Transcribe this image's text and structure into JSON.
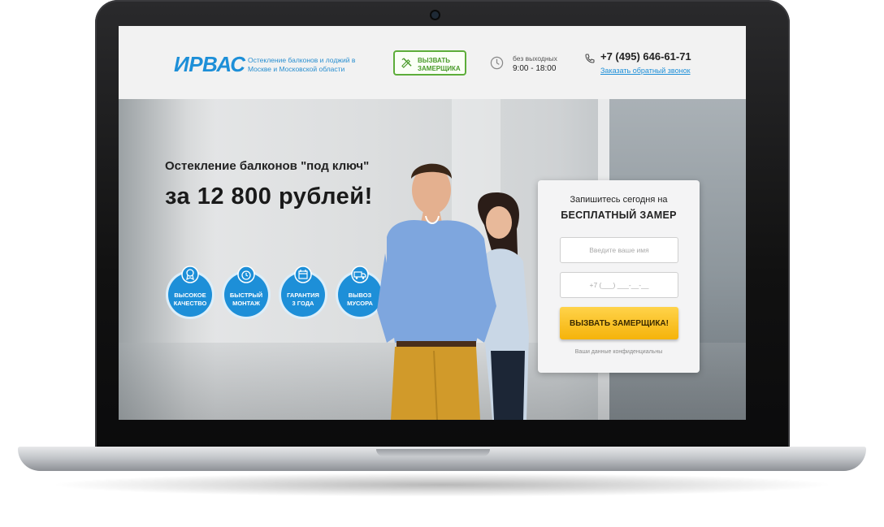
{
  "header": {
    "logo": "ИРВАС",
    "tagline": "Остекление балконов и лоджий в Москве и Московской области",
    "call_button_line1": "ВЫЗВАТЬ",
    "call_button_line2": "ЗАМЕРЩИКА",
    "hours_label": "без выходных",
    "hours": "9:00 - 18:00",
    "phone": "+7 (495) 646-61-71",
    "callback_link": "Заказать обратный звонок"
  },
  "hero": {
    "subtitle": "Остекление балконов \"под ключ\"",
    "price": "за  12 800 рублей!",
    "badges": [
      {
        "line1": "ВЫСОКОЕ",
        "line2": "КАЧЕСТВО",
        "icon": "medal-icon"
      },
      {
        "line1": "БЫСТРЫЙ",
        "line2": "МОНТАЖ",
        "icon": "clock-icon"
      },
      {
        "line1": "ГАРАНТИЯ",
        "line2": "3 ГОДА",
        "icon": "calendar-icon"
      },
      {
        "line1": "ВЫВОЗ",
        "line2": "МУСОРА",
        "icon": "truck-icon"
      }
    ]
  },
  "form": {
    "title": "Запишитесь сегодня на",
    "subtitle": "БЕСПЛАТНЫЙ ЗАМЕР",
    "name_placeholder": "Введите ваше имя",
    "phone_placeholder": "+7 (___) ___-__-__",
    "submit": "ВЫЗВАТЬ ЗАМЕРЩИКА!",
    "note": "Ваши данные конфиденциальны"
  },
  "colors": {
    "brand_blue": "#1d8fd8",
    "green": "#5dad3a",
    "cta_yellow": "#f5b30a"
  }
}
